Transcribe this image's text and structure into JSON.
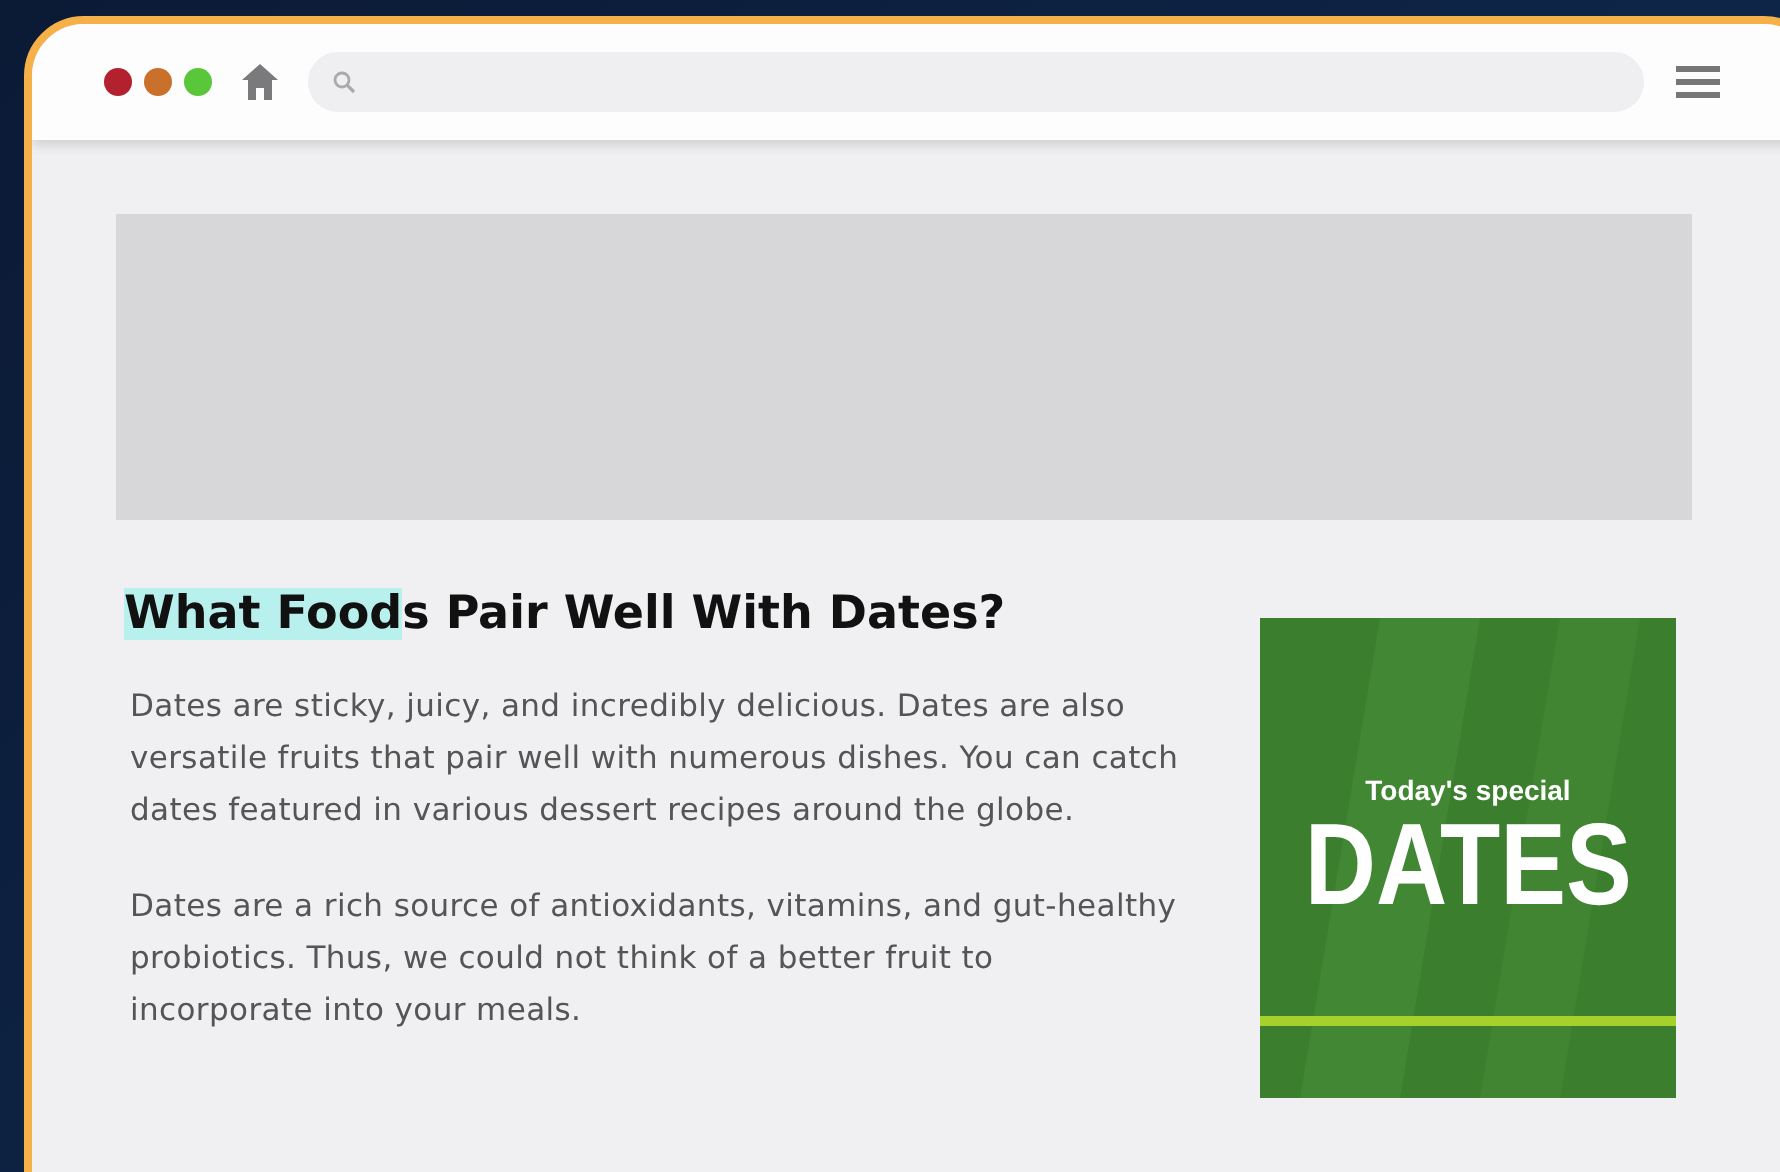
{
  "article": {
    "title_parts": [
      {
        "text": "What Food",
        "highlighted": true
      },
      {
        "text": "s Pair Well With Dates?",
        "highlighted": false
      }
    ],
    "paragraphs": [
      "Dates are sticky, juicy, and incredibly delicious. Dates are also versatile fruits that pair well with numerous dishes. You can catch dates featured in various dessert recipes around the globe.",
      "Dates are a rich source of antioxidants, vitamins, and gut-healthy probiotics. Thus, we could not think of a better fruit to incorporate into your meals."
    ]
  },
  "promo": {
    "subtitle": "Today's special",
    "title": "DATES"
  }
}
